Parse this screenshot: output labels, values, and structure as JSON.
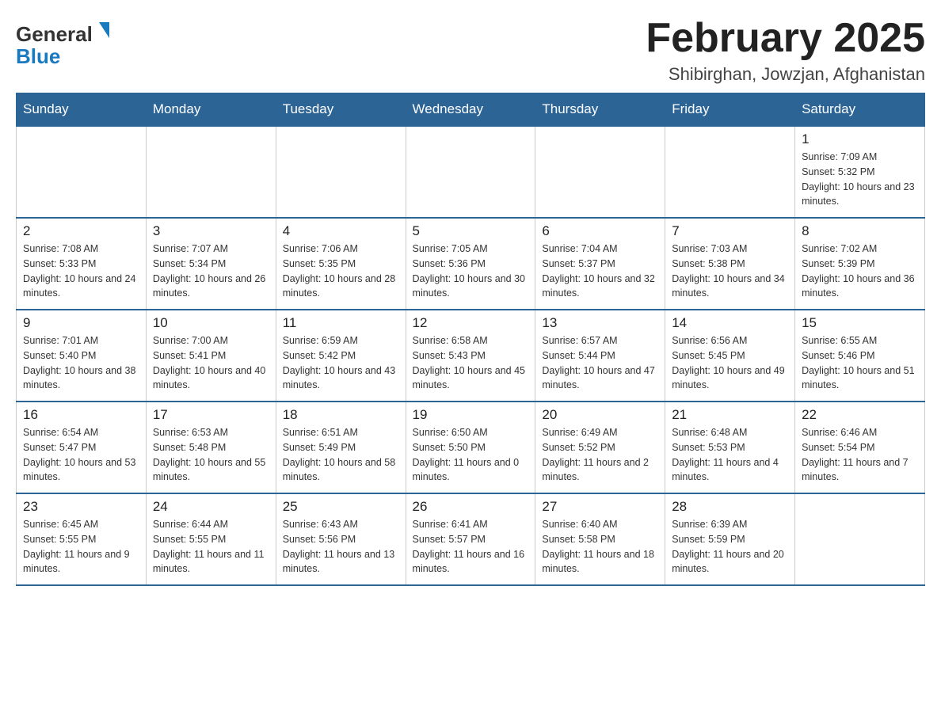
{
  "header": {
    "logo": {
      "general": "General",
      "blue": "Blue",
      "arrow": "▶"
    },
    "title": "February 2025",
    "location": "Shibirghan, Jowzjan, Afghanistan"
  },
  "days_of_week": [
    "Sunday",
    "Monday",
    "Tuesday",
    "Wednesday",
    "Thursday",
    "Friday",
    "Saturday"
  ],
  "weeks": [
    [
      {
        "day": "",
        "info": ""
      },
      {
        "day": "",
        "info": ""
      },
      {
        "day": "",
        "info": ""
      },
      {
        "day": "",
        "info": ""
      },
      {
        "day": "",
        "info": ""
      },
      {
        "day": "",
        "info": ""
      },
      {
        "day": "1",
        "info": "Sunrise: 7:09 AM\nSunset: 5:32 PM\nDaylight: 10 hours and 23 minutes."
      }
    ],
    [
      {
        "day": "2",
        "info": "Sunrise: 7:08 AM\nSunset: 5:33 PM\nDaylight: 10 hours and 24 minutes."
      },
      {
        "day": "3",
        "info": "Sunrise: 7:07 AM\nSunset: 5:34 PM\nDaylight: 10 hours and 26 minutes."
      },
      {
        "day": "4",
        "info": "Sunrise: 7:06 AM\nSunset: 5:35 PM\nDaylight: 10 hours and 28 minutes."
      },
      {
        "day": "5",
        "info": "Sunrise: 7:05 AM\nSunset: 5:36 PM\nDaylight: 10 hours and 30 minutes."
      },
      {
        "day": "6",
        "info": "Sunrise: 7:04 AM\nSunset: 5:37 PM\nDaylight: 10 hours and 32 minutes."
      },
      {
        "day": "7",
        "info": "Sunrise: 7:03 AM\nSunset: 5:38 PM\nDaylight: 10 hours and 34 minutes."
      },
      {
        "day": "8",
        "info": "Sunrise: 7:02 AM\nSunset: 5:39 PM\nDaylight: 10 hours and 36 minutes."
      }
    ],
    [
      {
        "day": "9",
        "info": "Sunrise: 7:01 AM\nSunset: 5:40 PM\nDaylight: 10 hours and 38 minutes."
      },
      {
        "day": "10",
        "info": "Sunrise: 7:00 AM\nSunset: 5:41 PM\nDaylight: 10 hours and 40 minutes."
      },
      {
        "day": "11",
        "info": "Sunrise: 6:59 AM\nSunset: 5:42 PM\nDaylight: 10 hours and 43 minutes."
      },
      {
        "day": "12",
        "info": "Sunrise: 6:58 AM\nSunset: 5:43 PM\nDaylight: 10 hours and 45 minutes."
      },
      {
        "day": "13",
        "info": "Sunrise: 6:57 AM\nSunset: 5:44 PM\nDaylight: 10 hours and 47 minutes."
      },
      {
        "day": "14",
        "info": "Sunrise: 6:56 AM\nSunset: 5:45 PM\nDaylight: 10 hours and 49 minutes."
      },
      {
        "day": "15",
        "info": "Sunrise: 6:55 AM\nSunset: 5:46 PM\nDaylight: 10 hours and 51 minutes."
      }
    ],
    [
      {
        "day": "16",
        "info": "Sunrise: 6:54 AM\nSunset: 5:47 PM\nDaylight: 10 hours and 53 minutes."
      },
      {
        "day": "17",
        "info": "Sunrise: 6:53 AM\nSunset: 5:48 PM\nDaylight: 10 hours and 55 minutes."
      },
      {
        "day": "18",
        "info": "Sunrise: 6:51 AM\nSunset: 5:49 PM\nDaylight: 10 hours and 58 minutes."
      },
      {
        "day": "19",
        "info": "Sunrise: 6:50 AM\nSunset: 5:50 PM\nDaylight: 11 hours and 0 minutes."
      },
      {
        "day": "20",
        "info": "Sunrise: 6:49 AM\nSunset: 5:52 PM\nDaylight: 11 hours and 2 minutes."
      },
      {
        "day": "21",
        "info": "Sunrise: 6:48 AM\nSunset: 5:53 PM\nDaylight: 11 hours and 4 minutes."
      },
      {
        "day": "22",
        "info": "Sunrise: 6:46 AM\nSunset: 5:54 PM\nDaylight: 11 hours and 7 minutes."
      }
    ],
    [
      {
        "day": "23",
        "info": "Sunrise: 6:45 AM\nSunset: 5:55 PM\nDaylight: 11 hours and 9 minutes."
      },
      {
        "day": "24",
        "info": "Sunrise: 6:44 AM\nSunset: 5:55 PM\nDaylight: 11 hours and 11 minutes."
      },
      {
        "day": "25",
        "info": "Sunrise: 6:43 AM\nSunset: 5:56 PM\nDaylight: 11 hours and 13 minutes."
      },
      {
        "day": "26",
        "info": "Sunrise: 6:41 AM\nSunset: 5:57 PM\nDaylight: 11 hours and 16 minutes."
      },
      {
        "day": "27",
        "info": "Sunrise: 6:40 AM\nSunset: 5:58 PM\nDaylight: 11 hours and 18 minutes."
      },
      {
        "day": "28",
        "info": "Sunrise: 6:39 AM\nSunset: 5:59 PM\nDaylight: 11 hours and 20 minutes."
      },
      {
        "day": "",
        "info": ""
      }
    ]
  ]
}
